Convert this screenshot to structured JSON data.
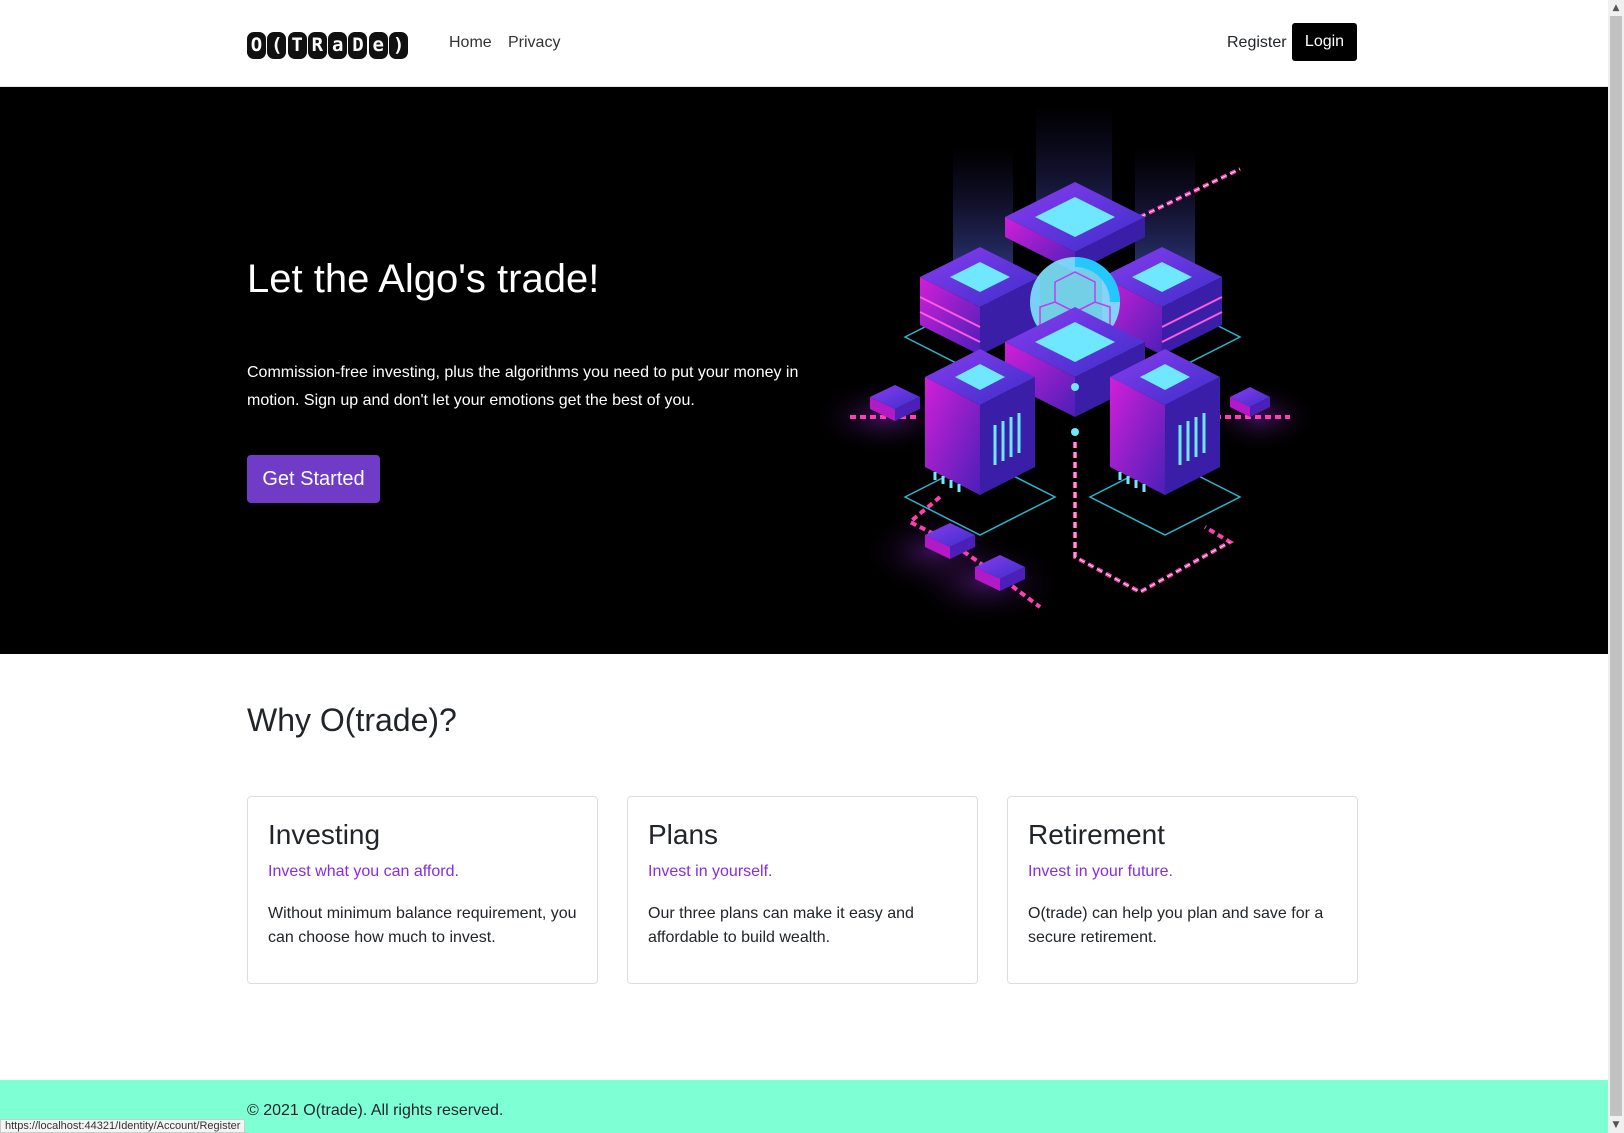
{
  "nav": {
    "logo_text": "O(TRaDe)",
    "links": [
      "Home",
      "Privacy"
    ],
    "register": "Register",
    "login": "Login"
  },
  "hero": {
    "title": "Let the Algo's trade!",
    "text": "Commission-free investing, plus the algorithms you need to put your money in motion. Sign up and don't let your emotions get the best of you.",
    "cta": "Get Started"
  },
  "why": {
    "title": "Why O(trade)?",
    "cards": [
      {
        "title": "Investing",
        "subtitle": "Invest what you can afford.",
        "text": "Without minimum balance requirement, you can choose how much to invest."
      },
      {
        "title": "Plans",
        "subtitle": "Invest in yourself.",
        "text": "Our three plans can make it easy and affordable to build wealth."
      },
      {
        "title": "Retirement",
        "subtitle": "Invest in your future.",
        "text": "O(trade) can help you plan and save for a secure retirement."
      }
    ]
  },
  "footer": {
    "text": "© 2021 O(trade). All rights reserved.",
    "status_url": "https://localhost:44321/Identity/Account/Register"
  },
  "colors": {
    "cta": "#6f3bc7",
    "accent_text": "#8a2be2",
    "footer_bg": "#7fffd4",
    "hero_bg": "#000000"
  }
}
